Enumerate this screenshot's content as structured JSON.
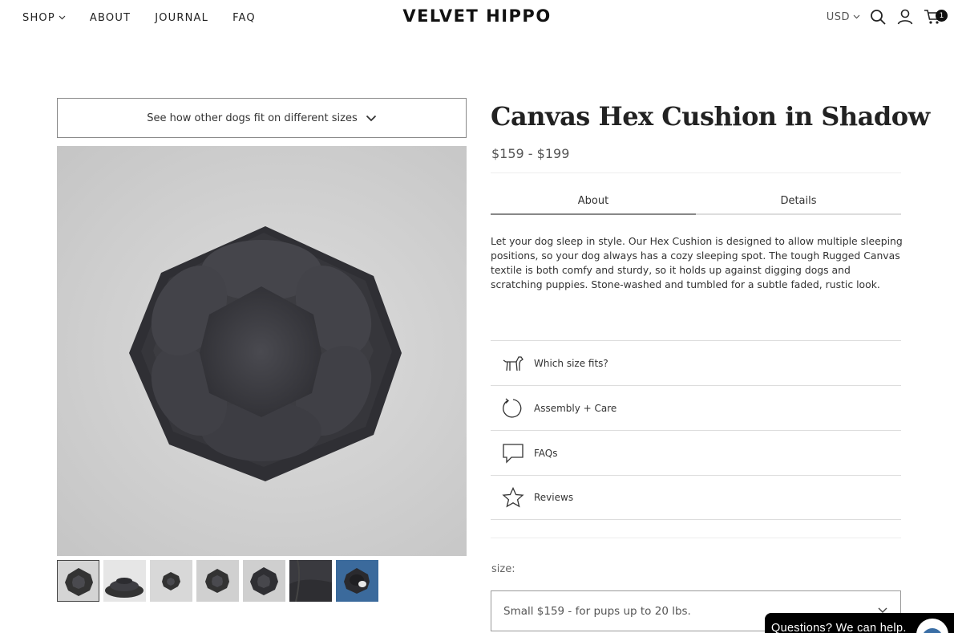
{
  "header": {
    "nav": [
      {
        "label": "SHOP",
        "has_dropdown": true
      },
      {
        "label": "ABOUT"
      },
      {
        "label": "JOURNAL"
      },
      {
        "label": "FAQ"
      }
    ],
    "logo": "VELVET HIPPO",
    "currency": "USD",
    "cart_count": "1",
    "icons": [
      "search-icon",
      "account-icon",
      "cart-icon"
    ]
  },
  "gallery": {
    "fit_dropdown_label": "See how other dogs fit on different sizes",
    "thumbnail_count": 7,
    "active_thumbnail": 1
  },
  "product": {
    "title": "Canvas Hex Cushion in Shadow",
    "price": "$159 - $199",
    "tabs": [
      {
        "label": "About",
        "active": true
      },
      {
        "label": "Details",
        "active": false
      }
    ],
    "description": "Let your dog sleep in style. Our Hex Cushion is designed to allow multiple sleeping positions, so your dog always has a cozy sleeping spot. The tough Rugged Canvas textile is both comfy and sturdy, so it holds up against digging dogs and scratching puppies. Stone-washed and tumbled for a subtle faded, rustic look.",
    "accordion": [
      {
        "label": "Which size fits?",
        "icon": "dog-icon"
      },
      {
        "label": "Assembly + Care",
        "icon": "refresh-icon"
      },
      {
        "label": "FAQs",
        "icon": "chat-icon"
      },
      {
        "label": "Reviews",
        "icon": "star-icon"
      }
    ],
    "size_label": "size:",
    "size_selected": "Small $159 - for pups up to 20 lbs."
  },
  "chat": {
    "label": "Questions? We can help."
  },
  "colors": {
    "text": "#222222",
    "muted": "#555555",
    "chat_bg": "#000000",
    "product_fabric": "#3a3a3e"
  }
}
